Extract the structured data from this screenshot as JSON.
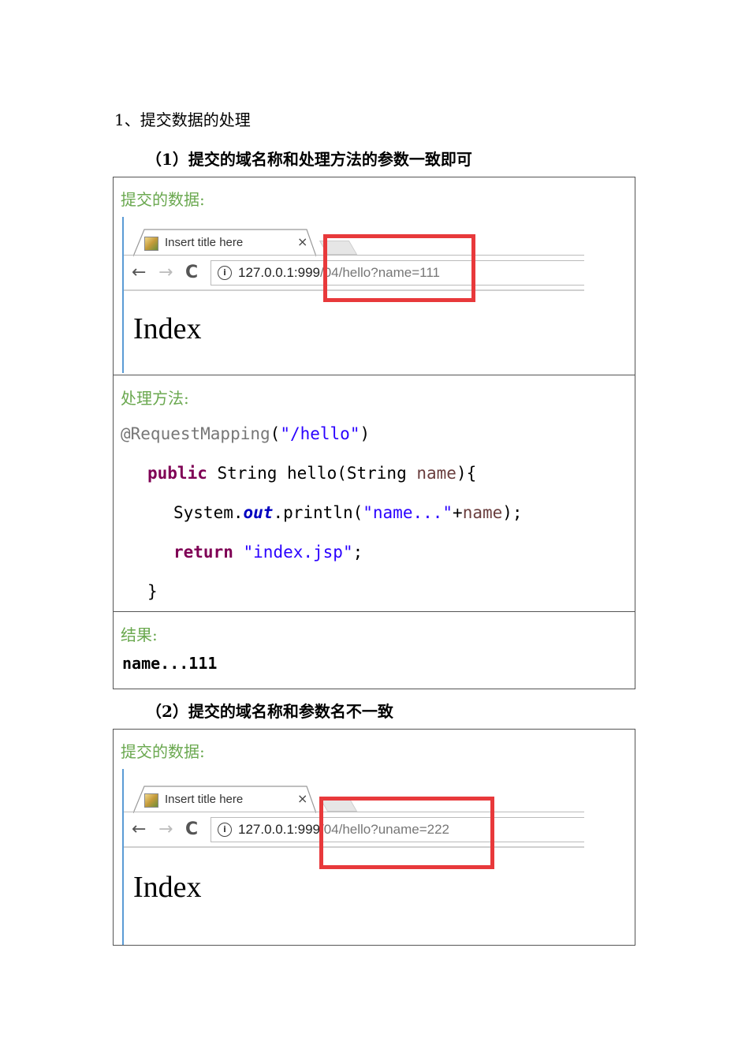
{
  "heading": "1、提交数据的处理",
  "section1": {
    "title": "（1）提交的域名称和处理方法的参数一致即可",
    "submitted_label": "提交的数据:",
    "browser": {
      "tab_title": "Insert title here",
      "close": "×",
      "back": "←",
      "forward": "→",
      "reload": "C",
      "info": "i",
      "url_host": "127.0.0.1:999",
      "url_path": "/04/hello?name=111",
      "page_heading": "Index"
    },
    "handler_label": "处理方法:",
    "code": {
      "annotation": "@RequestMapping",
      "paren_open": "(",
      "mapping": "\"/hello\"",
      "paren_close": ")",
      "kw_public": "public",
      "sig_mid": " String hello(String ",
      "param": "name",
      "sig_end": "){",
      "sys": "System.",
      "out": "out",
      "println": ".println(",
      "str_name": "\"name...\"",
      "plus": "+",
      "var_name": "name",
      "call_end": ");",
      "kw_return": "return",
      "ret_str": "\"index.jsp\"",
      "semicolon": ";",
      "brace": "}"
    },
    "result_label": "结果:",
    "result_value": "name...111"
  },
  "section2": {
    "title": "（2）提交的域名称和参数名不一致",
    "submitted_label": "提交的数据:",
    "browser": {
      "tab_title": "Insert title here",
      "close": "×",
      "back": "←",
      "forward": "→",
      "reload": "C",
      "info": "i",
      "url_host": "127.0.0.1:999",
      "url_path": "/04/hello?uname=222",
      "page_heading": "Index"
    }
  },
  "colors": {
    "label_green": "#6aa84f",
    "highlight_red": "#e8393b",
    "keyword": "#7f0055",
    "string": "#2a00ff"
  }
}
